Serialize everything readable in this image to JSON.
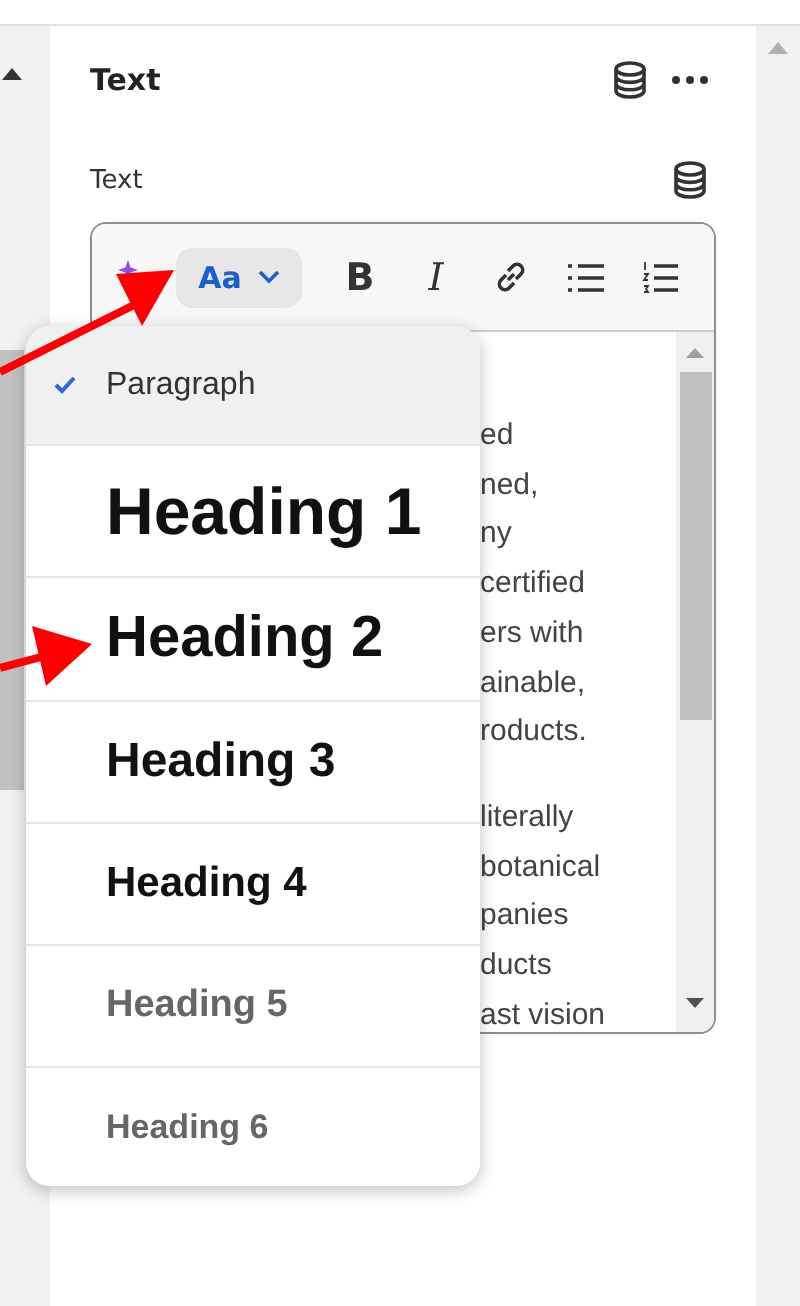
{
  "panel": {
    "title": "Text"
  },
  "field": {
    "label": "Text"
  },
  "toolbar": [
    {
      "kind": "ai"
    },
    {
      "kind": "format",
      "label": "Aa"
    },
    {
      "kind": "bold",
      "label": "B"
    },
    {
      "kind": "italic",
      "label": "I"
    },
    {
      "kind": "link"
    },
    {
      "kind": "bullets"
    },
    {
      "kind": "numbered"
    }
  ],
  "content_paragraphs": [
    [
      "ed",
      "ned,",
      "ny",
      "certified",
      "ers with",
      "ainable,",
      "roducts."
    ],
    [
      "literally",
      "botanical",
      "panies",
      "ducts",
      "ast vision"
    ]
  ],
  "menu": [
    {
      "kind": "paragraph",
      "label": "Paragraph",
      "selected": true
    },
    {
      "kind": "heading1",
      "label": "Heading 1",
      "selected": false
    },
    {
      "kind": "heading2",
      "label": "Heading 2",
      "selected": false
    },
    {
      "kind": "heading3",
      "label": "Heading 3",
      "selected": false
    },
    {
      "kind": "heading4",
      "label": "Heading 4",
      "selected": false
    },
    {
      "kind": "heading5",
      "label": "Heading 5",
      "selected": false
    },
    {
      "kind": "heading6",
      "label": "Heading 6",
      "selected": false
    }
  ]
}
